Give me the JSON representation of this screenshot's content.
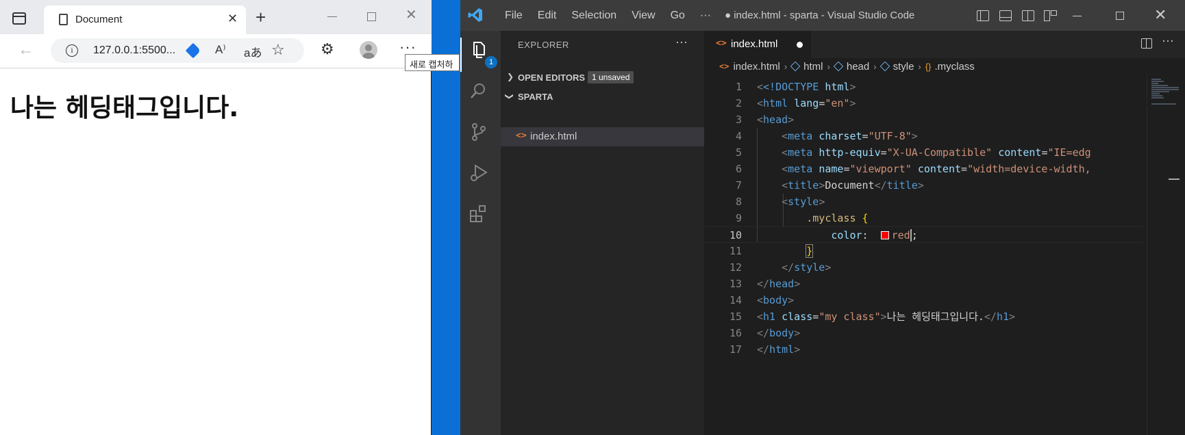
{
  "browser": {
    "tab_title": "Document",
    "url": "127.0.0.1:5500...",
    "tooltip": "새로 캡처하",
    "heading": "나는 헤딩태그입니다.",
    "read_aloud_glyph": "A⁾",
    "translate_glyph": "aあ"
  },
  "vscode": {
    "menu": [
      "File",
      "Edit",
      "Selection",
      "View",
      "Go",
      "···"
    ],
    "window_title": "● index.html - sparta - Visual Studio Code",
    "explorer_badge": "1",
    "sidebar": {
      "title": "EXPLORER",
      "open_editors_label": "OPEN EDITORS",
      "unsaved_badge": "1 unsaved",
      "folder_label": "SPARTA",
      "file_name": "index.html"
    },
    "tab": {
      "name": "index.html"
    },
    "breadcrumbs": [
      "index.html",
      "html",
      "head",
      "style",
      ".myclass"
    ],
    "code_lines": [
      {
        "n": "1"
      },
      {
        "n": "2"
      },
      {
        "n": "3"
      },
      {
        "n": "4"
      },
      {
        "n": "5"
      },
      {
        "n": "6"
      },
      {
        "n": "7"
      },
      {
        "n": "8"
      },
      {
        "n": "9"
      },
      {
        "n": "10"
      },
      {
        "n": "11"
      },
      {
        "n": "12"
      },
      {
        "n": "13"
      },
      {
        "n": "14"
      },
      {
        "n": "15"
      },
      {
        "n": "16"
      },
      {
        "n": "17"
      }
    ],
    "code": {
      "l1_a": "<!DOCTYPE",
      "l1_b": " html",
      "l1_c": ">",
      "l2_tag": "html",
      "l2_attr": "lang",
      "l2_val": "\"en\"",
      "l3_tag": "head",
      "l4_tag": "meta",
      "l4_attr": "charset",
      "l4_val": "\"UTF-8\"",
      "l5_tag": "meta",
      "l5_attr1": "http-equiv",
      "l5_val1": "\"X-UA-Compatible\"",
      "l5_attr2": "content",
      "l5_val2": "\"IE=edg",
      "l6_tag": "meta",
      "l6_attr1": "name",
      "l6_val1": "\"viewport\"",
      "l6_attr2": "content",
      "l6_val2": "\"width=device-width,",
      "l7_tag": "title",
      "l7_text": "Document",
      "l7_close": "title",
      "l8_tag": "style",
      "l9_sel": ".myclass",
      "l9_brace": "{",
      "l10_prop": "color",
      "l10_val": "red",
      "l10_end": ";",
      "l11_brace": "}",
      "l12_tag": "style",
      "l13_tag": "head",
      "l14_tag": "body",
      "l15_tag": "h1",
      "l15_attr": "class",
      "l15_val": "\"my class\"",
      "l15_text": "나는 헤딩태그입니다.",
      "l15_close": "h1",
      "l16_tag": "body",
      "l17_tag": "html"
    }
  },
  "colors": {
    "desktop": "#0a6fd6",
    "vscode_accent": "#0e70c0",
    "swatch_red": "#ff0000"
  }
}
